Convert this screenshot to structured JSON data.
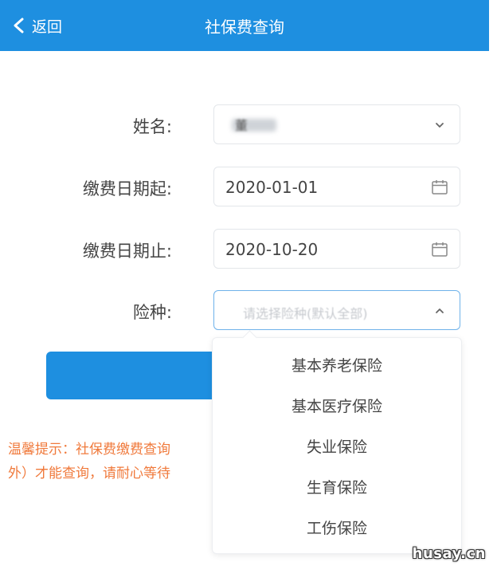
{
  "header": {
    "back_label": "返回",
    "title": "社保费查询",
    "background": "#1e8fe0"
  },
  "form": {
    "name": {
      "label": "姓名:",
      "value": "董"
    },
    "start_date": {
      "label": "缴费日期起:",
      "value": "2020-01-01"
    },
    "end_date": {
      "label": "缴费日期止:",
      "value": "2020-10-20"
    },
    "insurance_type": {
      "label": "险种:",
      "placeholder": "请选择险种(默认全部)"
    }
  },
  "dropdown": {
    "options": [
      "基本养老保险",
      "基本医疗保险",
      "失业保险",
      "生育保险",
      "工伤保险"
    ]
  },
  "tip": {
    "line1": "温馨提示：社保费缴费查询",
    "line2": "外）才能查询，请耐心等待"
  },
  "watermark": "husay.cn",
  "colors": {
    "accent": "#1e8fe0",
    "tip": "#f07a3c"
  }
}
